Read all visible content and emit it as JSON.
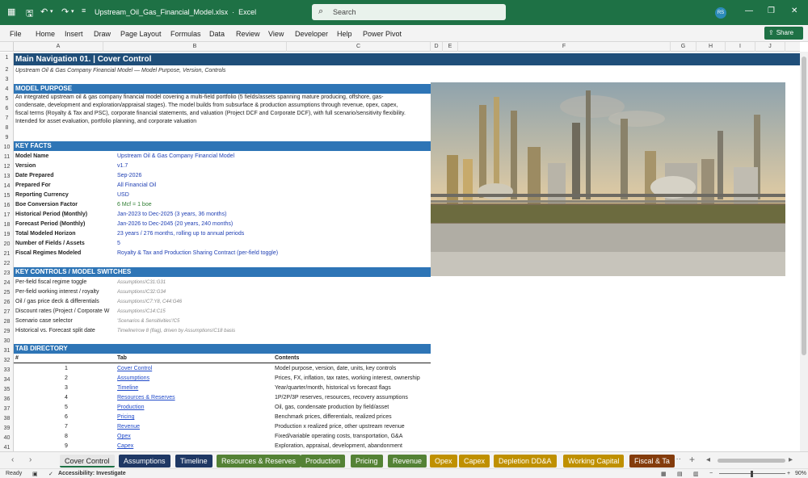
{
  "window": {
    "filename": "Upstream_Oil_Gas_Financial_Model.xlsx",
    "app": "Excel",
    "search_placeholder": "Search",
    "user_initials": "RS"
  },
  "menu": [
    "File",
    "Home",
    "Insert",
    "Draw",
    "Page Layout",
    "Formulas",
    "Data",
    "Review",
    "View",
    "Developer",
    "Help",
    "Power Pivot"
  ],
  "share_label": "Share",
  "columns": [
    "A",
    "B",
    "C",
    "D",
    "E",
    "F",
    "G",
    "H",
    "I",
    "J"
  ],
  "rows": [
    "1",
    "2",
    "3",
    "4",
    "5",
    "6",
    "7",
    "8",
    "9",
    "10",
    "11",
    "12",
    "13",
    "14",
    "15",
    "16",
    "17",
    "18",
    "19",
    "20",
    "21",
    "22",
    "23",
    "24",
    "25",
    "26",
    "27",
    "28",
    "29",
    "30",
    "31",
    "32",
    "33",
    "34",
    "35",
    "36",
    "37",
    "38",
    "39",
    "40",
    "41"
  ],
  "sheet": {
    "title": "Main Navigation 01.  |  Cover Control",
    "subtitle": "Upstream Oil & Gas Company Financial Model — Model Purpose, Version, Controls",
    "purpose_header": "MODEL PURPOSE",
    "purpose_lines": [
      "An integrated upstream oil & gas company financial model covering a multi-field portfolio (5 fields/assets spanning mature producing, offshore, gas-",
      "condensate, development and exploration/appraisal stages). The model builds from subsurface & production assumptions through revenue, opex, capex,",
      "fiscal terms (Royalty & Tax and PSC), corporate financial statements, and valuation (Project DCF and Corporate DCF), with full scenario/sensitivity flexibility.",
      "Intended for asset evaluation, portfolio planning, and corporate valuation"
    ],
    "facts_header": "KEY FACTS",
    "facts": [
      {
        "label": "Model Name",
        "value": "Upstream Oil & Gas Company Financial Model"
      },
      {
        "label": "Version",
        "value": "v1.7"
      },
      {
        "label": "Date Prepared",
        "value": "Sep-2026"
      },
      {
        "label": "Prepared For",
        "value": "All Financial Oil"
      },
      {
        "label": "Reporting Currency",
        "value": "USD"
      },
      {
        "label": "Boe Conversion Factor",
        "value": "6 Mcf = 1 boe"
      },
      {
        "label": "Historical Period (Monthly)",
        "value": "Jan-2023 to Dec-2025 (3 years, 36 months)"
      },
      {
        "label": "Forecast Period (Monthly)",
        "value": "Jan-2026 to Dec-2045 (20 years, 240 months)"
      },
      {
        "label": "Total Modeled Horizon",
        "value": "23 years / 276 months, rolling up to annual periods"
      },
      {
        "label": "Number of Fields / Assets",
        "value": "5"
      },
      {
        "label": "Fiscal Regimes Modeled",
        "value": "Royalty & Tax and Production Sharing Contract (per-field toggle)"
      }
    ],
    "controls_header": "KEY CONTROLS / MODEL SWITCHES",
    "controls": [
      {
        "label": "Per-field fiscal regime toggle",
        "ref": "Assumptions!C31:G31"
      },
      {
        "label": "Per-field working interest / royalty",
        "ref": "Assumptions!C32:G34"
      },
      {
        "label": "Oil / gas price deck & differentials",
        "ref": "Assumptions!C7:Y8, C44:G46"
      },
      {
        "label": "Discount rates (Project / Corporate W",
        "ref": "Assumptions!C14:C15"
      },
      {
        "label": "Scenario case selector",
        "ref": "'Scenarios & Sensitivities'!C5"
      },
      {
        "label": "Historical vs. Forecast split date",
        "ref": "Timeline!row 8 (flag), driven by Assumptions!C18 basis"
      }
    ],
    "tabdir_header": "TAB DIRECTORY",
    "tabdir_cols": {
      "num": "#",
      "tab": "Tab",
      "contents": "Contents"
    },
    "tabdir": [
      {
        "num": "1",
        "tab": "Cover Control",
        "contents": "Model purpose, version, date, units, key controls"
      },
      {
        "num": "2",
        "tab": "Assumptions",
        "contents": "Prices, FX, inflation, tax rates, working interest, ownership"
      },
      {
        "num": "3",
        "tab": "Timeline",
        "contents": "Year/quarter/month, historical vs forecast flags"
      },
      {
        "num": "4",
        "tab": "Resources & Reserves",
        "contents": "1P/2P/3P reserves, resources, recovery assumptions"
      },
      {
        "num": "5",
        "tab": "Production",
        "contents": "Oil, gas, condensate production by field/asset"
      },
      {
        "num": "6",
        "tab": "Pricing",
        "contents": "Benchmark prices, differentials, realized prices"
      },
      {
        "num": "7",
        "tab": "Revenue",
        "contents": "Production x realized price, other upstream revenue"
      },
      {
        "num": "8",
        "tab": "Opex",
        "contents": "Fixed/variable operating costs, transportation, G&A"
      },
      {
        "num": "9",
        "tab": "Capex",
        "contents": "Exploration, appraisal, development, abandonment"
      }
    ]
  },
  "sheet_tabs": [
    {
      "label": "Cover Control",
      "color": "#e6e6e6",
      "active": true
    },
    {
      "label": "Assumptions",
      "color": "#1f3864"
    },
    {
      "label": "Timeline",
      "color": "#1f3864"
    },
    {
      "label": "Resources & Reserves",
      "color": "#548235"
    },
    {
      "label": "Production",
      "color": "#548235"
    },
    {
      "label": "Pricing",
      "color": "#548235"
    },
    {
      "label": "Revenue",
      "color": "#548235"
    },
    {
      "label": "Opex",
      "color": "#bf9000"
    },
    {
      "label": "Capex",
      "color": "#bf9000"
    },
    {
      "label": "Depletion DD&A",
      "color": "#bf9000"
    },
    {
      "label": "Working Capital",
      "color": "#bf9000"
    },
    {
      "label": "Fiscal & Ta",
      "color": "#843c0c"
    }
  ],
  "status": {
    "ready": "Ready",
    "accessibility": "Accessibility: Investigate",
    "zoom": "90%"
  },
  "colors": {
    "excel_green": "#1e7145",
    "band_blue": "#2e75b6",
    "title_navy": "#1f4e79",
    "link_blue": "#1f49c9"
  },
  "image": {
    "alt_icon": "refinery-photo"
  }
}
